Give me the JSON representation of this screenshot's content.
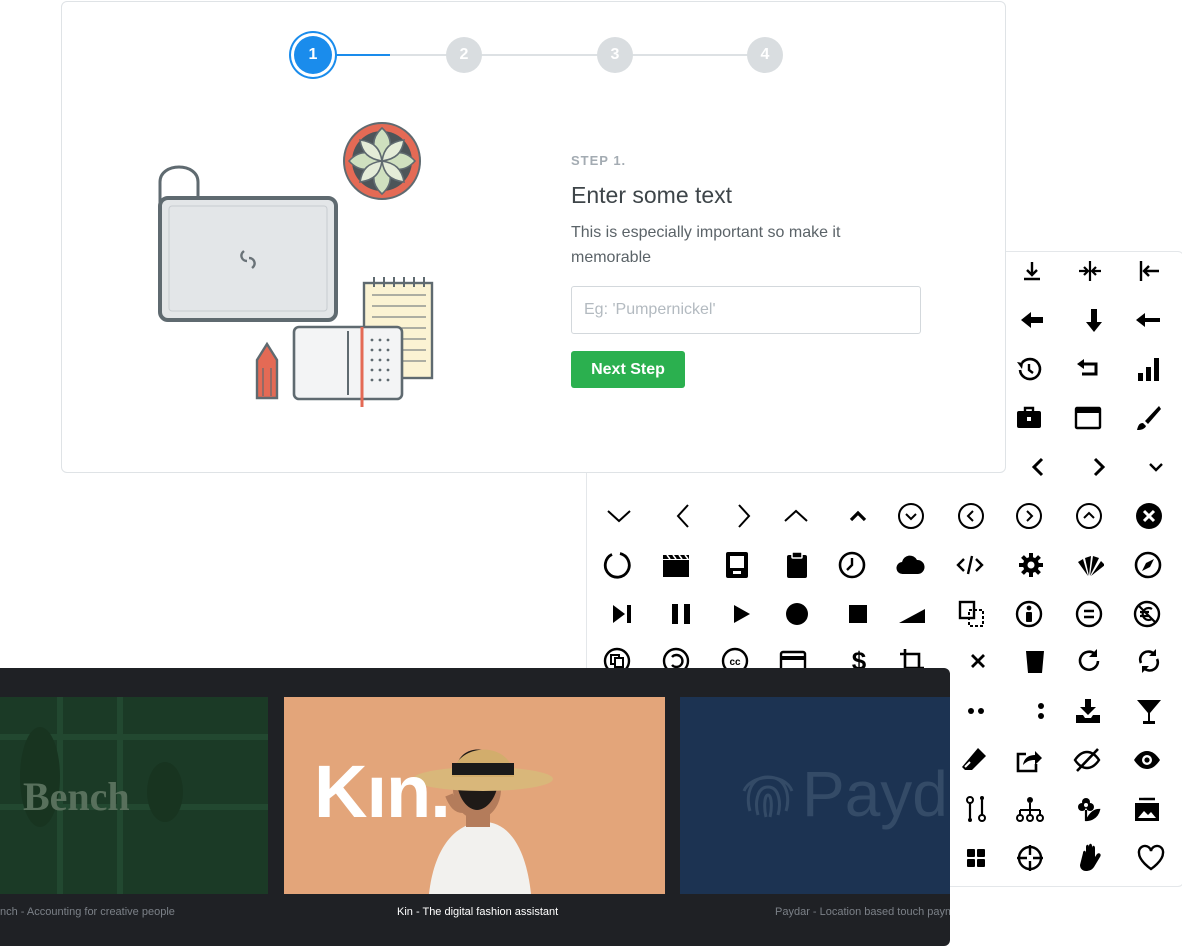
{
  "wizard": {
    "steps": [
      "1",
      "2",
      "3",
      "4"
    ],
    "active_step": 1,
    "eyebrow": "STEP 1.",
    "title": "Enter some text",
    "description": "This is especially important so make it memorable",
    "input": {
      "placeholder": "Eg: 'Pumpernickel'",
      "value": ""
    },
    "next_label": "Next Step"
  },
  "icon_grid": {
    "icons": [
      "align-bottom-icon",
      "compress-horizontal-icon",
      "align-left-icon",
      "arrow-left-bold-icon",
      "arrow-down-bold-icon",
      "arrow-left-icon",
      "history-icon",
      "undo-arrow-icon",
      "signal-bars-icon",
      "toolbox-icon",
      "browser-window-icon",
      "brush-icon",
      "chevron-left-bold-icon",
      "chevron-right-bold-icon",
      "chevron-down-small-icon",
      "chevron-down-icon",
      "chevron-left-icon",
      "chevron-right-icon",
      "chevron-up-icon",
      "caret-up-bold-icon",
      "chevron-circle-down-icon",
      "chevron-circle-left-icon",
      "chevron-circle-right-icon",
      "chevron-circle-up-icon",
      "close-circle-icon",
      "circle-notch-icon",
      "clapperboard-icon",
      "tablet-icon",
      "clipboard-icon",
      "clock-icon",
      "cloud-icon",
      "code-icon",
      "cog-icon",
      "color-swatch-icon",
      "compass-icon",
      "skip-forward-icon",
      "pause-icon",
      "play-icon",
      "record-icon",
      "stop-icon",
      "volume-ramp-icon",
      "copy-dashed-icon",
      "accessibility-icon",
      "equals-circle-icon",
      "euro-circle-icon",
      "copy-circle-icon",
      "copyleft-icon",
      "creative-commons-icon",
      "credit-card-icon",
      "dollar-icon",
      "crop-icon",
      "close-icon",
      "trash-bin-icon",
      "redo-icon",
      "sync-icon",
      "ellipsis-horizontal-icon",
      "ellipsis-vertical-icon",
      "download-tray-icon",
      "cocktail-icon",
      "eraser-icon",
      "share-icon",
      "eye-slash-icon",
      "eye-icon",
      "git-compare-icon",
      "sitemap-icon",
      "florist-icon",
      "image-gallery-icon",
      "grid-icon",
      "crosshair-icon",
      "hand-icon",
      "heart-icon"
    ]
  },
  "showcase": {
    "slides": [
      {
        "logo": "Bench",
        "caption": "nch - Accounting for creative people"
      },
      {
        "logo": "Kın.",
        "caption": "Kin - The digital fashion assistant"
      },
      {
        "logo": "Payda",
        "caption": "Paydar - Location based touch payme"
      }
    ]
  },
  "colors": {
    "accent_blue": "#1a8cec",
    "button_green": "#2bb04f",
    "showcase_bg": "#1f2125"
  }
}
